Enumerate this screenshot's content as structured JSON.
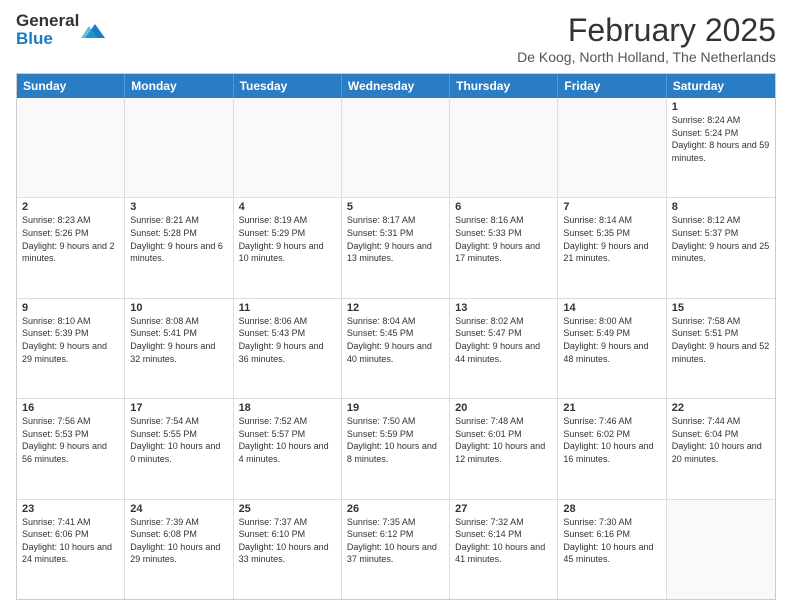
{
  "header": {
    "logo_line1": "General",
    "logo_line2": "Blue",
    "month_title": "February 2025",
    "location": "De Koog, North Holland, The Netherlands"
  },
  "days_of_week": [
    "Sunday",
    "Monday",
    "Tuesday",
    "Wednesday",
    "Thursday",
    "Friday",
    "Saturday"
  ],
  "weeks": [
    [
      {
        "day": "",
        "info": ""
      },
      {
        "day": "",
        "info": ""
      },
      {
        "day": "",
        "info": ""
      },
      {
        "day": "",
        "info": ""
      },
      {
        "day": "",
        "info": ""
      },
      {
        "day": "",
        "info": ""
      },
      {
        "day": "1",
        "info": "Sunrise: 8:24 AM\nSunset: 5:24 PM\nDaylight: 8 hours and 59 minutes."
      }
    ],
    [
      {
        "day": "2",
        "info": "Sunrise: 8:23 AM\nSunset: 5:26 PM\nDaylight: 9 hours and 2 minutes."
      },
      {
        "day": "3",
        "info": "Sunrise: 8:21 AM\nSunset: 5:28 PM\nDaylight: 9 hours and 6 minutes."
      },
      {
        "day": "4",
        "info": "Sunrise: 8:19 AM\nSunset: 5:29 PM\nDaylight: 9 hours and 10 minutes."
      },
      {
        "day": "5",
        "info": "Sunrise: 8:17 AM\nSunset: 5:31 PM\nDaylight: 9 hours and 13 minutes."
      },
      {
        "day": "6",
        "info": "Sunrise: 8:16 AM\nSunset: 5:33 PM\nDaylight: 9 hours and 17 minutes."
      },
      {
        "day": "7",
        "info": "Sunrise: 8:14 AM\nSunset: 5:35 PM\nDaylight: 9 hours and 21 minutes."
      },
      {
        "day": "8",
        "info": "Sunrise: 8:12 AM\nSunset: 5:37 PM\nDaylight: 9 hours and 25 minutes."
      }
    ],
    [
      {
        "day": "9",
        "info": "Sunrise: 8:10 AM\nSunset: 5:39 PM\nDaylight: 9 hours and 29 minutes."
      },
      {
        "day": "10",
        "info": "Sunrise: 8:08 AM\nSunset: 5:41 PM\nDaylight: 9 hours and 32 minutes."
      },
      {
        "day": "11",
        "info": "Sunrise: 8:06 AM\nSunset: 5:43 PM\nDaylight: 9 hours and 36 minutes."
      },
      {
        "day": "12",
        "info": "Sunrise: 8:04 AM\nSunset: 5:45 PM\nDaylight: 9 hours and 40 minutes."
      },
      {
        "day": "13",
        "info": "Sunrise: 8:02 AM\nSunset: 5:47 PM\nDaylight: 9 hours and 44 minutes."
      },
      {
        "day": "14",
        "info": "Sunrise: 8:00 AM\nSunset: 5:49 PM\nDaylight: 9 hours and 48 minutes."
      },
      {
        "day": "15",
        "info": "Sunrise: 7:58 AM\nSunset: 5:51 PM\nDaylight: 9 hours and 52 minutes."
      }
    ],
    [
      {
        "day": "16",
        "info": "Sunrise: 7:56 AM\nSunset: 5:53 PM\nDaylight: 9 hours and 56 minutes."
      },
      {
        "day": "17",
        "info": "Sunrise: 7:54 AM\nSunset: 5:55 PM\nDaylight: 10 hours and 0 minutes."
      },
      {
        "day": "18",
        "info": "Sunrise: 7:52 AM\nSunset: 5:57 PM\nDaylight: 10 hours and 4 minutes."
      },
      {
        "day": "19",
        "info": "Sunrise: 7:50 AM\nSunset: 5:59 PM\nDaylight: 10 hours and 8 minutes."
      },
      {
        "day": "20",
        "info": "Sunrise: 7:48 AM\nSunset: 6:01 PM\nDaylight: 10 hours and 12 minutes."
      },
      {
        "day": "21",
        "info": "Sunrise: 7:46 AM\nSunset: 6:02 PM\nDaylight: 10 hours and 16 minutes."
      },
      {
        "day": "22",
        "info": "Sunrise: 7:44 AM\nSunset: 6:04 PM\nDaylight: 10 hours and 20 minutes."
      }
    ],
    [
      {
        "day": "23",
        "info": "Sunrise: 7:41 AM\nSunset: 6:06 PM\nDaylight: 10 hours and 24 minutes."
      },
      {
        "day": "24",
        "info": "Sunrise: 7:39 AM\nSunset: 6:08 PM\nDaylight: 10 hours and 29 minutes."
      },
      {
        "day": "25",
        "info": "Sunrise: 7:37 AM\nSunset: 6:10 PM\nDaylight: 10 hours and 33 minutes."
      },
      {
        "day": "26",
        "info": "Sunrise: 7:35 AM\nSunset: 6:12 PM\nDaylight: 10 hours and 37 minutes."
      },
      {
        "day": "27",
        "info": "Sunrise: 7:32 AM\nSunset: 6:14 PM\nDaylight: 10 hours and 41 minutes."
      },
      {
        "day": "28",
        "info": "Sunrise: 7:30 AM\nSunset: 6:16 PM\nDaylight: 10 hours and 45 minutes."
      },
      {
        "day": "",
        "info": ""
      }
    ]
  ]
}
